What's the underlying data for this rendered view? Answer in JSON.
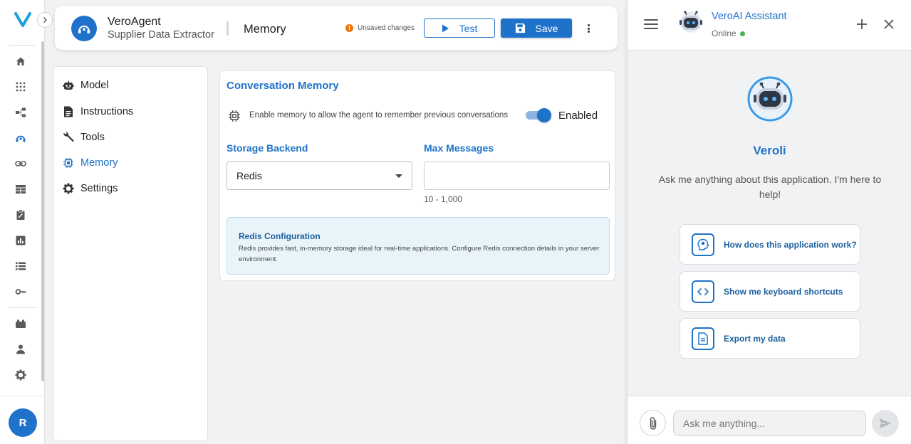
{
  "colors": {
    "primary": "#1f72c9",
    "warning": "#e8750a",
    "online": "#4caf50",
    "info_bg": "#e8f4fa"
  },
  "rail": {
    "logo_letter": "V",
    "icons": [
      "home-icon",
      "apps-grid-icon",
      "workflow-icon",
      "agent-icon",
      "link-icon",
      "table-icon",
      "clipboard-icon",
      "chart-icon",
      "list-icon",
      "key-icon",
      "blocks-icon",
      "person-icon",
      "gear-icon"
    ],
    "active": "agent-icon",
    "avatar_initial": "R"
  },
  "header": {
    "agent_name": "VeroAgent",
    "agent_subtitle": "Supplier Data Extractor",
    "section": "Memory",
    "unsaved": "Unsaved changes",
    "unsaved_icon": "!",
    "test_label": "Test",
    "save_label": "Save"
  },
  "menu": {
    "items": [
      {
        "label": "Model",
        "icon": "robot-icon"
      },
      {
        "label": "Instructions",
        "icon": "document-icon"
      },
      {
        "label": "Tools",
        "icon": "wrench-icon"
      },
      {
        "label": "Memory",
        "icon": "chip-icon",
        "active": true
      },
      {
        "label": "Settings",
        "icon": "gear-icon"
      }
    ]
  },
  "memory": {
    "title": "Conversation Memory",
    "enable_description": "Enable memory to allow the agent to remember previous conversations",
    "enabled": true,
    "enabled_label": "Enabled",
    "storage_label": "Storage Backend",
    "storage_value": "Redis",
    "max_label": "Max Messages",
    "max_value": "",
    "max_hint": "10 - 1,000",
    "info_title": "Redis Configuration",
    "info_text": "Redis provides fast, in-memory storage ideal for real-time applications. Configure Redis connection details in your server environment."
  },
  "assistant": {
    "title": "VeroAI Assistant",
    "status": "Online",
    "bot_name": "Veroli",
    "welcome": "Ask me anything about this application. I'm here to help!",
    "suggestions": [
      {
        "label": "How does this application work?",
        "icon": "lightbulb-head-icon"
      },
      {
        "label": "Show me keyboard shortcuts",
        "icon": "code-icon"
      },
      {
        "label": "Export my data",
        "icon": "file-icon"
      }
    ],
    "input_placeholder": "Ask me anything...",
    "input_value": ""
  }
}
